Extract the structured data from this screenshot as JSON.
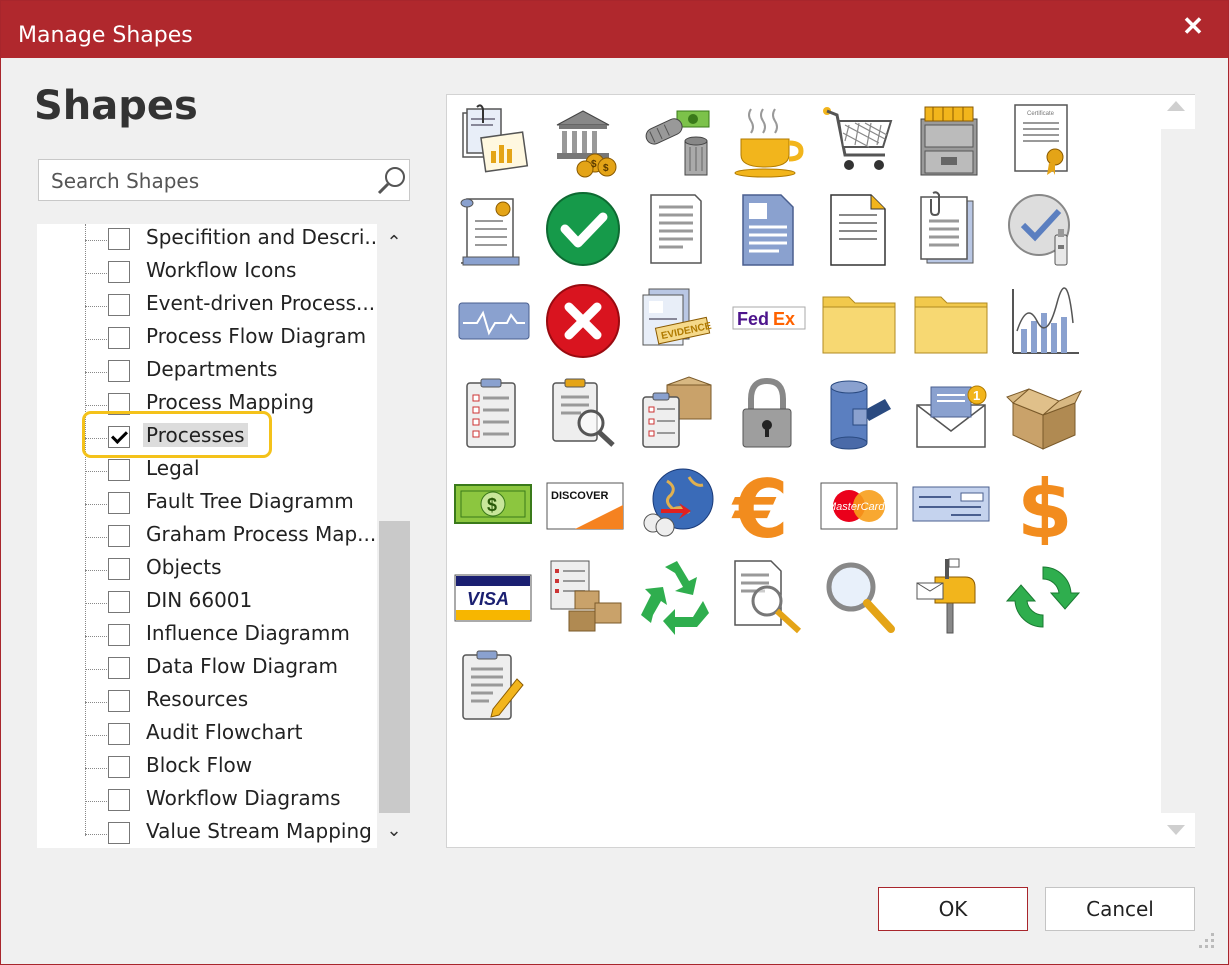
{
  "window": {
    "title": "Manage Shapes",
    "close_label": "✕"
  },
  "panel": {
    "heading": "Shapes"
  },
  "search": {
    "placeholder": "Search Shapes",
    "value": ""
  },
  "tree": {
    "items": [
      {
        "label": "Specifition and Descri...",
        "checked": false
      },
      {
        "label": "Workflow Icons",
        "checked": false
      },
      {
        "label": "Event-driven Process...",
        "checked": false
      },
      {
        "label": "Process Flow Diagram",
        "checked": false
      },
      {
        "label": "Departments",
        "checked": false
      },
      {
        "label": "Process Mapping",
        "checked": false
      },
      {
        "label": "Processes",
        "checked": true
      },
      {
        "label": "Legal",
        "checked": false
      },
      {
        "label": "Fault Tree Diagramm",
        "checked": false
      },
      {
        "label": "Graham Process Map...",
        "checked": false
      },
      {
        "label": "Objects",
        "checked": false
      },
      {
        "label": "DIN 66001",
        "checked": false
      },
      {
        "label": "Influence Diagramm",
        "checked": false
      },
      {
        "label": "Data Flow Diagram",
        "checked": false
      },
      {
        "label": "Resources",
        "checked": false
      },
      {
        "label": "Audit Flowchart",
        "checked": false
      },
      {
        "label": "Block Flow",
        "checked": false
      },
      {
        "label": "Workflow Diagrams",
        "checked": false
      },
      {
        "label": "Value Stream Mapping",
        "checked": false
      }
    ]
  },
  "gallery": {
    "shapes": [
      {
        "icon": "report-chart-icon"
      },
      {
        "icon": "bank-money-icon"
      },
      {
        "icon": "money-shredder-icon"
      },
      {
        "icon": "coffee-cup-icon"
      },
      {
        "icon": "shopping-cart-icon"
      },
      {
        "icon": "file-cabinet-icon"
      },
      {
        "icon": "certificate-icon"
      },
      {
        "icon": "diploma-scroll-icon"
      },
      {
        "icon": "green-check-icon"
      },
      {
        "icon": "document-icon"
      },
      {
        "icon": "blue-document-icon"
      },
      {
        "icon": "folded-document-icon"
      },
      {
        "icon": "clipped-documents-icon"
      },
      {
        "icon": "check-usb-icon"
      },
      {
        "icon": "monitor-signal-icon"
      },
      {
        "icon": "red-x-icon"
      },
      {
        "icon": "evidence-icon"
      },
      {
        "icon": "fedex-icon"
      },
      {
        "icon": "folder-icon"
      },
      {
        "icon": "folder-icon"
      },
      {
        "icon": "bar-line-chart-icon"
      },
      {
        "icon": "checklist-clipboard-icon"
      },
      {
        "icon": "clipboard-search-icon"
      },
      {
        "icon": "clipboard-box-icon"
      },
      {
        "icon": "padlock-icon"
      },
      {
        "icon": "database-server-icon"
      },
      {
        "icon": "mail-notification-icon"
      },
      {
        "icon": "open-box-icon"
      },
      {
        "icon": "dollar-bill-icon"
      },
      {
        "icon": "discover-card-icon"
      },
      {
        "icon": "global-money-icon"
      },
      {
        "icon": "euro-icon"
      },
      {
        "icon": "mastercard-icon"
      },
      {
        "icon": "bank-check-icon"
      },
      {
        "icon": "dollar-sign-icon"
      },
      {
        "icon": "visa-card-icon"
      },
      {
        "icon": "inventory-boxes-icon"
      },
      {
        "icon": "recycle-icon"
      },
      {
        "icon": "document-magnifier-icon"
      },
      {
        "icon": "magnifier-icon"
      },
      {
        "icon": "mailbox-icon"
      },
      {
        "icon": "green-refresh-icon"
      },
      {
        "icon": "clipboard-pencil-icon"
      }
    ]
  },
  "brand_text": {
    "evidence": "EVIDENCE",
    "fedex_fed": "Fed",
    "fedex_ex": "Ex",
    "discover": "DISCOVER",
    "mastercard": "MasterCard",
    "visa": "VISA",
    "euro": "€",
    "dollar": "$",
    "badge": "1",
    "certificate": "Certificate"
  },
  "buttons": {
    "ok": "OK",
    "cancel": "Cancel"
  },
  "colors": {
    "titlebar": "#b0282d",
    "highlight": "#f4c21a",
    "dialog_bg": "#f0f0f0"
  }
}
